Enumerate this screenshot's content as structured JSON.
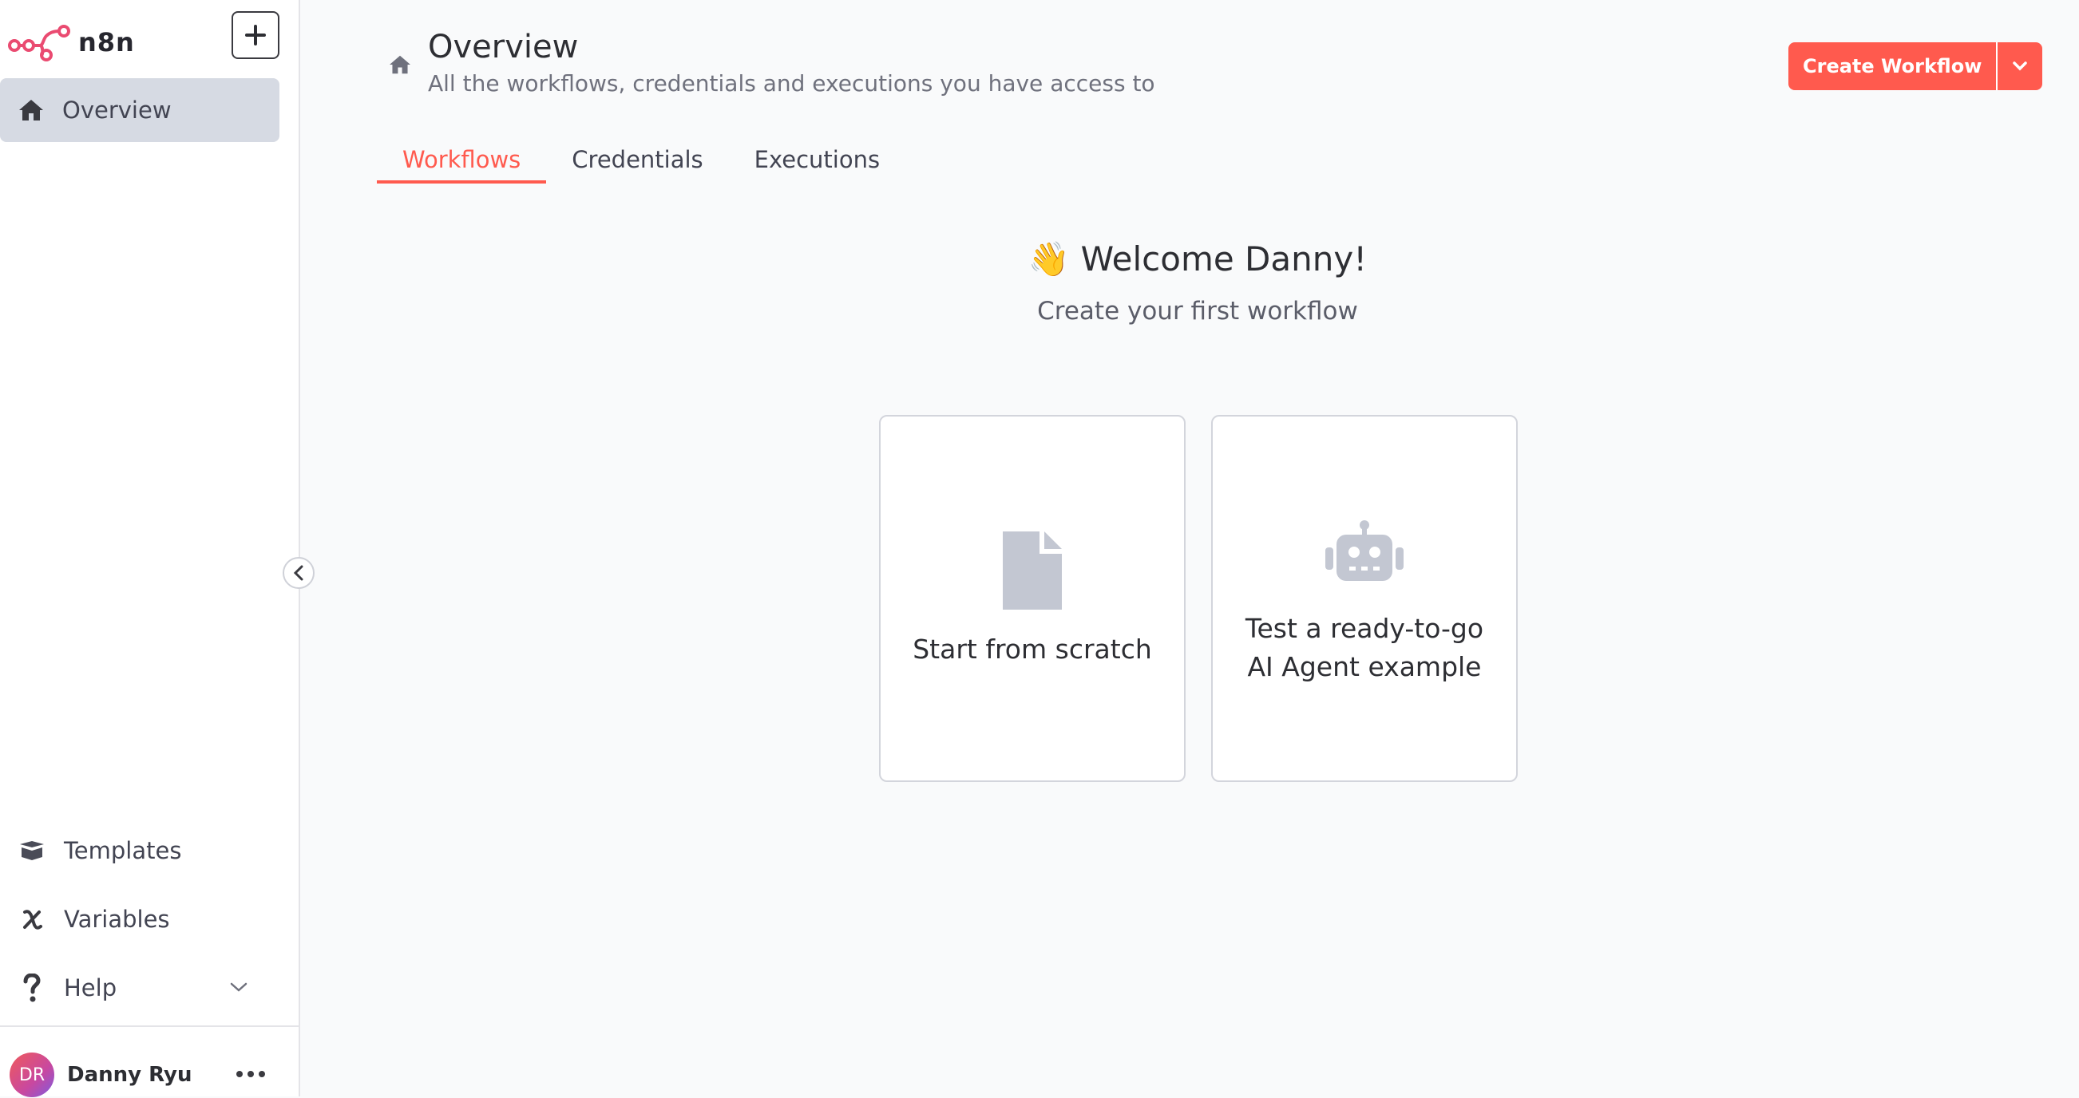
{
  "app": {
    "name": "n8n",
    "accent_color": "#ff5a4e"
  },
  "sidebar": {
    "logo_text": "n8n",
    "add_icon": "plus-icon",
    "overview_label": "Overview",
    "bottom_items": [
      {
        "label": "Templates",
        "icon": "templates-icon"
      },
      {
        "label": "Variables",
        "icon": "variables-icon"
      },
      {
        "label": "Help",
        "icon": "help-icon"
      }
    ],
    "user": {
      "initials": "DR",
      "name": "Danny Ryu"
    }
  },
  "header": {
    "title": "Overview",
    "subtitle": "All the workflows, credentials and executions you have access to",
    "create_button": "Create Workflow"
  },
  "tabs": [
    {
      "label": "Workflows",
      "active": true
    },
    {
      "label": "Credentials",
      "active": false
    },
    {
      "label": "Executions",
      "active": false
    }
  ],
  "welcome": {
    "emoji": "👋",
    "title": "Welcome Danny!",
    "subtitle": "Create your first workflow"
  },
  "cards": [
    {
      "label_lines": [
        "Start from scratch"
      ],
      "icon": "file-icon"
    },
    {
      "label_lines": [
        "Test a ready-to-go",
        "AI Agent example"
      ],
      "icon": "robot-icon"
    }
  ]
}
